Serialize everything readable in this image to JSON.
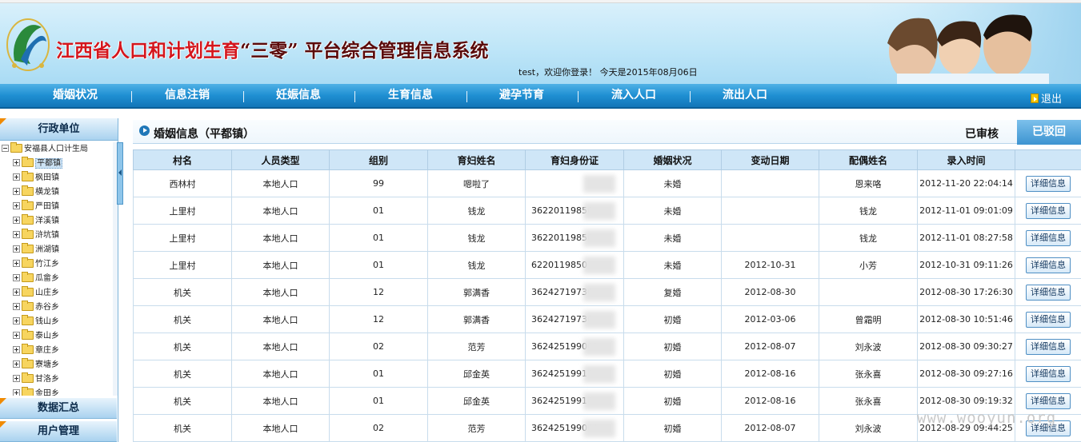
{
  "banner": {
    "title_prefix": "江西省人口和计划生育",
    "title_rest": "“三零” 平台综合管理信息系统",
    "welcome": "test，欢迎你登录！ 今天是2015年08月06日"
  },
  "nav": {
    "items": [
      "婚姻状况",
      "信息注销",
      "妊娠信息",
      "生育信息",
      "避孕节育",
      "流入人口",
      "流出人口"
    ],
    "logout": "退出"
  },
  "sidebar": {
    "header": "行政单位",
    "root": "安福县人口计生局",
    "nodes": [
      "平都镇",
      "枫田镇",
      "横龙镇",
      "严田镇",
      "洋溪镇",
      "浒坑镇",
      "洲湖镇",
      "竹江乡",
      "瓜畲乡",
      "山庄乡",
      "赤谷乡",
      "钱山乡",
      "泰山乡",
      "章庄乡",
      "寮塘乡",
      "甘洛乡",
      "金田乡"
    ],
    "footer1": "数据汇总",
    "footer2": "用户管理"
  },
  "content": {
    "title": "婚姻信息（平都镇）",
    "tab_approved": "已审核",
    "tab_returned": "已驳回",
    "columns": [
      "村名",
      "人员类型",
      "组别",
      "育妇姓名",
      "育妇身份证",
      "婚姻状况",
      "变动日期",
      "配偶姓名",
      "录入时间",
      ""
    ],
    "detail_label": "详细信息",
    "rows": [
      [
        "西林村",
        "本地人口",
        "99",
        "嗯啦了",
        "",
        "未婚",
        "",
        "恩来咯",
        "2012-11-20 22:04:14"
      ],
      [
        "上里村",
        "本地人口",
        "01",
        "钱龙",
        "36220119850",
        "未婚",
        "",
        "钱龙",
        "2012-11-01 09:01:09"
      ],
      [
        "上里村",
        "本地人口",
        "01",
        "钱龙",
        "36220119850",
        "未婚",
        "",
        "钱龙",
        "2012-11-01 08:27:58"
      ],
      [
        "上里村",
        "本地人口",
        "01",
        "钱龙",
        "6220119850",
        "未婚",
        "2012-10-31",
        "小芳",
        "2012-10-31 09:11:26"
      ],
      [
        "机关",
        "本地人口",
        "12",
        "郭满香",
        "36242719730",
        "复婚",
        "2012-08-30",
        "",
        "2012-08-30 17:26:30"
      ],
      [
        "机关",
        "本地人口",
        "12",
        "郭满香",
        "36242719730",
        "初婚",
        "2012-03-06",
        "曾霜明",
        "2012-08-30 10:51:46"
      ],
      [
        "机关",
        "本地人口",
        "02",
        "范芳",
        "362425199001",
        "初婚",
        "2012-08-07",
        "刘永波",
        "2012-08-30 09:30:27"
      ],
      [
        "机关",
        "本地人口",
        "01",
        "邱金英",
        "36242519911",
        "初婚",
        "2012-08-16",
        "张永喜",
        "2012-08-30 09:27:16"
      ],
      [
        "机关",
        "本地人口",
        "01",
        "邱金英",
        "36242519911",
        "初婚",
        "2012-08-16",
        "张永喜",
        "2012-08-30 09:19:32"
      ],
      [
        "机关",
        "本地人口",
        "02",
        "范芳",
        "362425199001",
        "初婚",
        "2012-08-07",
        "刘永波",
        "2012-08-29 09:44:25"
      ]
    ]
  },
  "watermark": "www.wooyun.org"
}
